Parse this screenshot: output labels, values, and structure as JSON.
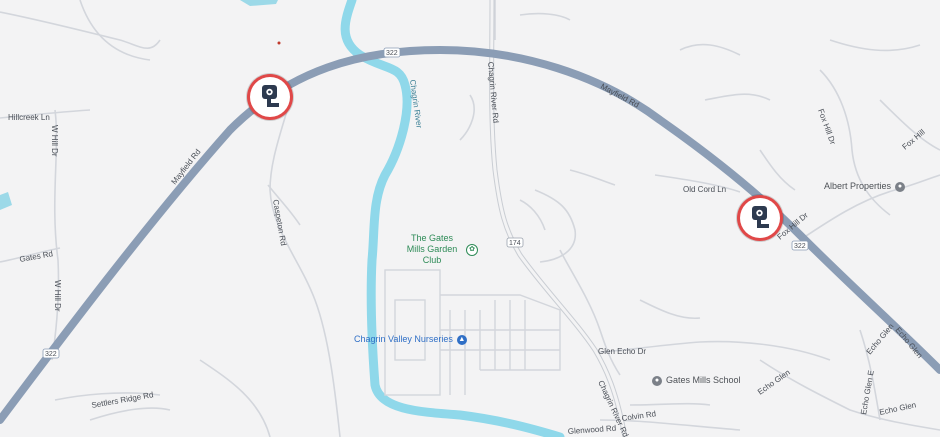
{
  "map": {
    "roads": {
      "mayfield_a": "Mayfield Rd",
      "mayfield_b": "Mayfield Rd",
      "chagrin_river_rd_top": "Chagrin River Rd",
      "chagrin_river_rd_bottom": "Chagrin River Rd",
      "hillcreek": "Hillcreek Ln",
      "w_hill_top": "W Hill Dr",
      "w_hill_bottom": "W Hill Dr",
      "gates": "Gates Rd",
      "caspeton": "Caspeton Rd",
      "settlers_ridge": "Settlers Ridge Rd",
      "old_cord": "Old Cord Ln",
      "fox_hill_top": "Fox Hill Dr",
      "fox_hill_mid": "Fox Hill Dr",
      "fox_hill_right": "Fox Hill",
      "glen_echo": "Glen Echo Dr",
      "echo_glen_a": "Echo Glen",
      "echo_glen_b": "Echo Glen",
      "echo_glen_c": "Echo Glen",
      "echo_glen_e": "Echo Glen E",
      "colvin": "Colvin Rd",
      "glenwood": "Glenwood Rd"
    },
    "river": "Chagrin River",
    "shields": {
      "s322_top": "322",
      "s322_left": "322",
      "s322_right": "322",
      "s174": "174"
    },
    "pois": {
      "garden_club": "The Gates Mills Garden Club",
      "nurseries": "Chagrin Valley Nurseries",
      "school": "Gates Mills School",
      "albert": "Albert Properties"
    },
    "cameras": [
      "traffic-camera",
      "traffic-camera"
    ]
  }
}
